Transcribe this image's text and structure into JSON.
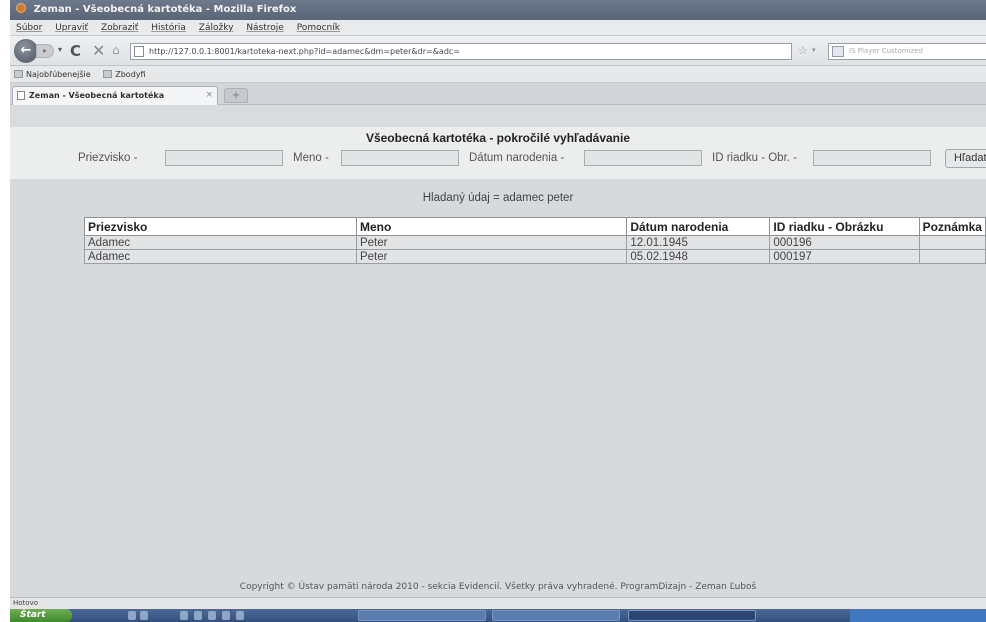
{
  "window": {
    "title": "Zeman - Všeobecná kartotéka - Mozilla Firefox"
  },
  "menubar": {
    "items": [
      "Súbor",
      "Upraviť",
      "Zobraziť",
      "História",
      "Záložky",
      "Nástroje",
      "Pomocník"
    ]
  },
  "navbar": {
    "back_icon": "←",
    "forward_icon": "▸",
    "dropdown_icon": "▾",
    "reload_icon": "C",
    "stop_icon": "✕",
    "home_icon": "⌂",
    "url": "http://127.0.0.1:8001/kartoteka-next.php?id=adamec&dm=peter&dr=&adc=",
    "bookmark_star_icon": "☆",
    "url_dropdown_icon": "▾",
    "search_placeholder": "IS Player Customized"
  },
  "bookmarks": {
    "items": [
      "Najobľúbenejšie",
      "Zbodyfi"
    ]
  },
  "tabs": {
    "active_label": "Zeman - Všeobecná kartotéka",
    "close_icon": "×",
    "new_tab_icon": "+"
  },
  "search_form": {
    "title": "Všeobecná kartotéka - pokročilé vyhľadávanie",
    "surname_label": "Priezvisko -",
    "surname_value": "",
    "name_label": "Meno -",
    "name_value": "",
    "birth_label": "Dátum narodenia -",
    "birth_value": "",
    "id_label": "ID riadku - Obr. -",
    "id_value": "",
    "search_button": "Hľadať"
  },
  "search_summary": "Hladaný údaj = adamec peter",
  "results_table": {
    "headers": [
      "Priezvisko",
      "Meno",
      "Dátum narodenia",
      "ID riadku - Obrázku",
      "Poznámka"
    ],
    "rows": [
      [
        "Adamec",
        "Peter",
        "12.01.1945",
        "000196",
        ""
      ],
      [
        "Adamec",
        "Peter",
        "05.02.1948",
        "000197",
        ""
      ]
    ]
  },
  "footer": {
    "copyright": "Copyright © Ústav pamäti národa 2010 - sekcia Evidencií. Všetky práva vyhradené. ProgramDizajn - Zeman Ľuboš"
  },
  "statusbar": {
    "text": "Hotovo"
  },
  "taskbar": {
    "start_label": "Štart"
  }
}
